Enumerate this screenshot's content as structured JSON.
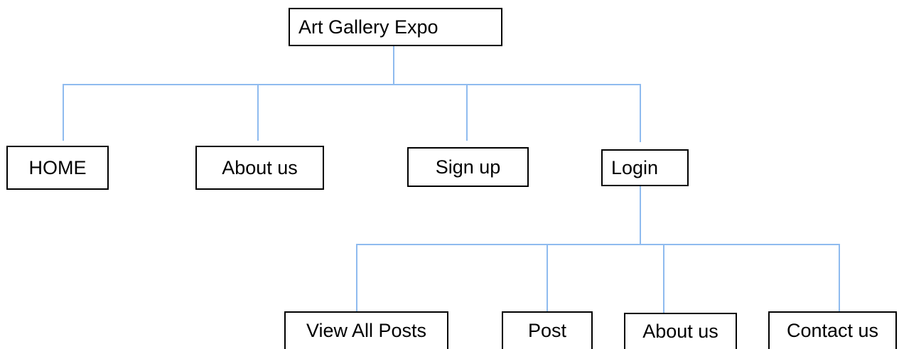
{
  "site_map": {
    "root": "Art Gallery Expo",
    "level1": [
      "HOME",
      "About us",
      "Sign up",
      "Login"
    ],
    "level2": [
      "View All Posts",
      "Post",
      "About us",
      "Contact us"
    ]
  },
  "colors": {
    "connector": "#8fbbef",
    "box_border": "#000000",
    "background": "#ffffff"
  }
}
